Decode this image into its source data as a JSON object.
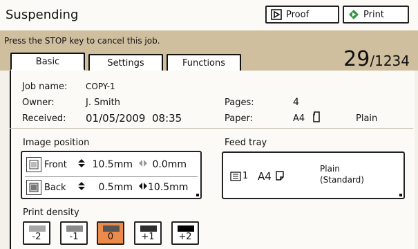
{
  "header": {
    "title": "Suspending",
    "proof_label": "Proof",
    "print_label": "Print"
  },
  "status": {
    "message": "Press the STOP key to cancel this job.",
    "current_count": "29",
    "total_count": "/1234"
  },
  "tabs": [
    {
      "label": "Basic",
      "active": true
    },
    {
      "label": "Settings",
      "active": false
    },
    {
      "label": "Functions",
      "active": false
    }
  ],
  "job": {
    "name_label": "Job name:",
    "name": "COPY-1",
    "owner_label": "Owner:",
    "owner": "J. Smith",
    "received_label": "Received:",
    "received": "01/05/2009  08:35",
    "pages_label": "Pages:",
    "pages": "4",
    "paper_label": "Paper:",
    "paper_size": "A4",
    "paper_type": "Plain"
  },
  "image_position": {
    "label": "Image position",
    "front": {
      "label": "Front",
      "vertical": "10.5mm",
      "horizontal": "0.0mm"
    },
    "back": {
      "label": "Back",
      "vertical": "0.5mm",
      "horizontal": "10.5mm"
    }
  },
  "feed_tray": {
    "label": "Feed tray",
    "tray_number": "1",
    "size": "A4",
    "type_line1": "Plain",
    "type_line2": "(Standard)"
  },
  "print_density": {
    "label": "Print density",
    "levels": [
      {
        "value": "-2",
        "swatch": "#a6a6a6"
      },
      {
        "value": "-1",
        "swatch": "#8a8a8a"
      },
      {
        "value": "0",
        "swatch": "#555555",
        "selected": true
      },
      {
        "value": "+1",
        "swatch": "#2e2e2e"
      },
      {
        "value": "+2",
        "swatch": "#000000"
      }
    ]
  },
  "colors": {
    "accent_bar": "#cfbf9f",
    "selected": "#ec8a4c"
  }
}
